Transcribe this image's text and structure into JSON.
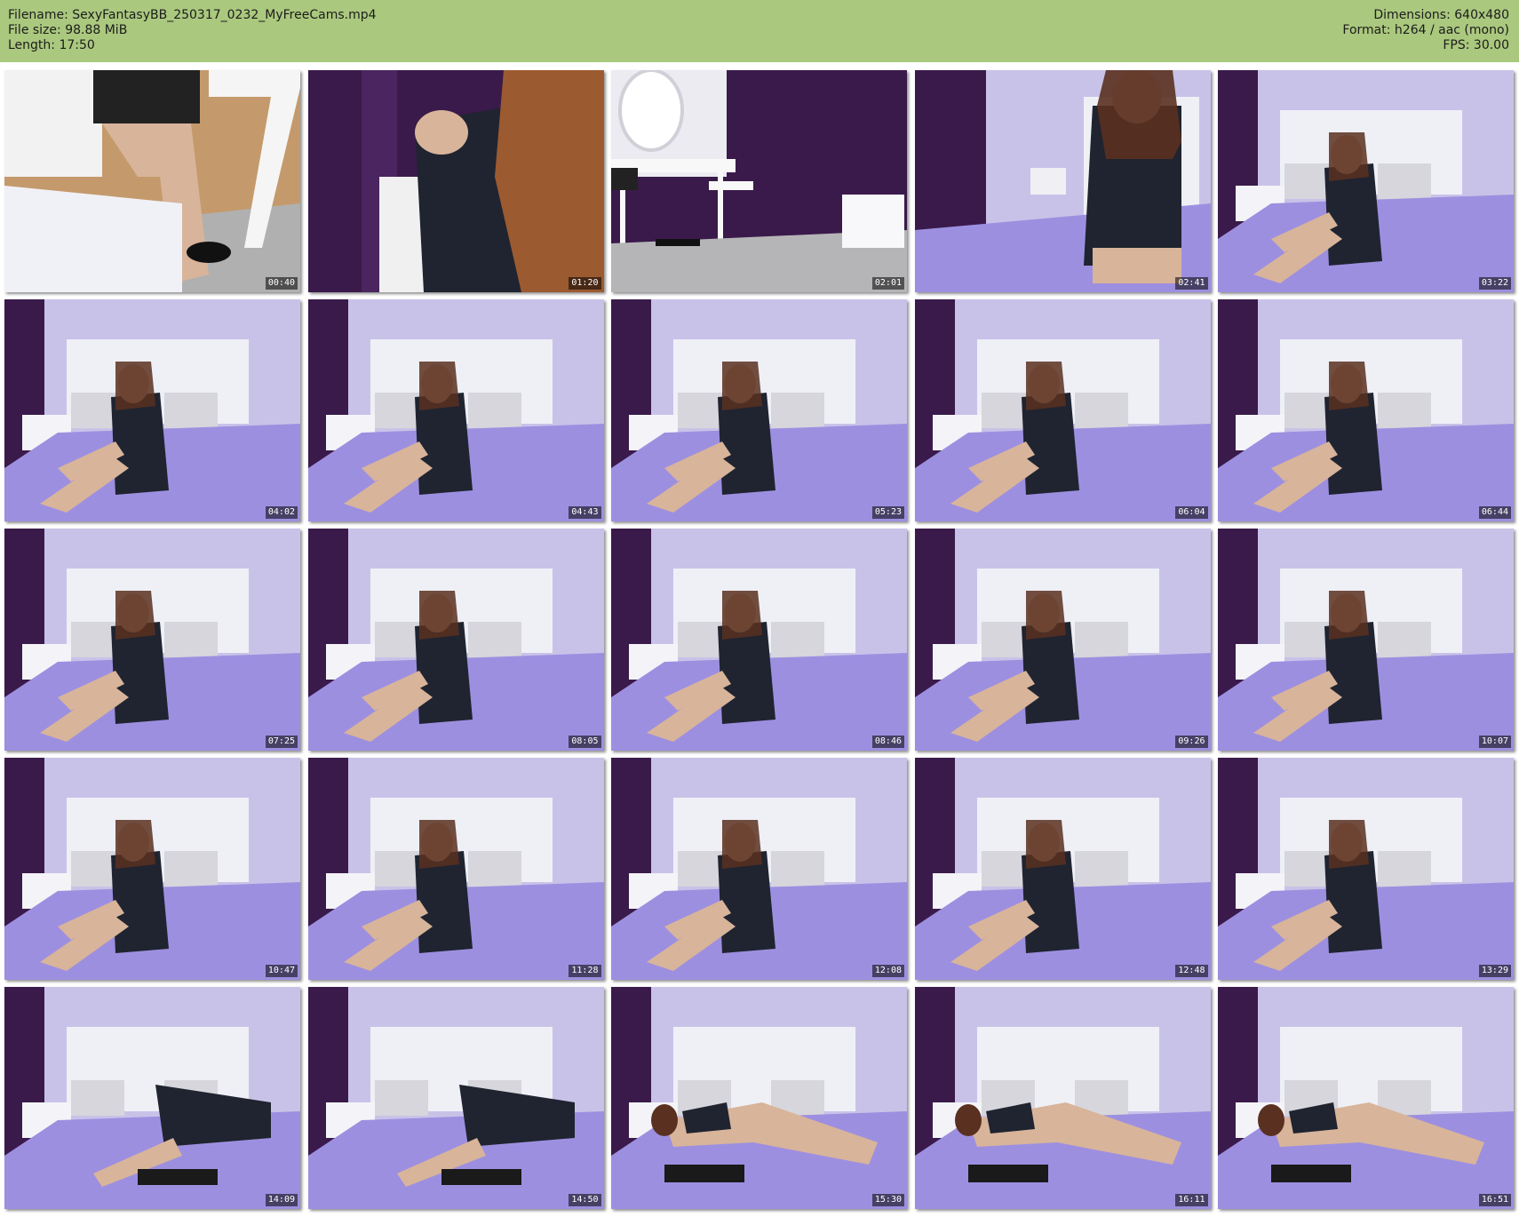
{
  "header": {
    "filename_label": "Filename: SexyFantasyBB_250317_0232_MyFreeCams.mp4",
    "filesize_label": "File size: 98.88 MiB",
    "length_label": "Length: 17:50",
    "dimensions_label": "Dimensions: 640x480",
    "format_label": "Format: h264 / aac (mono)",
    "fps_label": "FPS: 30.00"
  },
  "colors": {
    "header_bg": "#aac87e",
    "wall": "#c9c2e8",
    "curtain": "#3a1a4a",
    "bed": "#9d8fe0",
    "headboard": "#eef0f6",
    "floor": "#c49a6c",
    "dress": "#1f2430",
    "skin": "#d8b49a",
    "hair": "#5a3020"
  },
  "thumbnails": [
    {
      "time": "00:40",
      "scene": "desk-closeup"
    },
    {
      "time": "01:20",
      "scene": "standing-closeup"
    },
    {
      "time": "02:01",
      "scene": "room-vanity"
    },
    {
      "time": "02:41",
      "scene": "sitting-edge"
    },
    {
      "time": "03:22",
      "scene": "sitting-bed"
    },
    {
      "time": "04:02",
      "scene": "sitting-bed"
    },
    {
      "time": "04:43",
      "scene": "sitting-bed"
    },
    {
      "time": "05:23",
      "scene": "sitting-bed"
    },
    {
      "time": "06:04",
      "scene": "sitting-bed"
    },
    {
      "time": "06:44",
      "scene": "sitting-bed"
    },
    {
      "time": "07:25",
      "scene": "sitting-bed"
    },
    {
      "time": "08:05",
      "scene": "sitting-bed"
    },
    {
      "time": "08:46",
      "scene": "sitting-bed"
    },
    {
      "time": "09:26",
      "scene": "sitting-bed"
    },
    {
      "time": "10:07",
      "scene": "sitting-bed"
    },
    {
      "time": "10:47",
      "scene": "sitting-bed"
    },
    {
      "time": "11:28",
      "scene": "sitting-bed"
    },
    {
      "time": "12:08",
      "scene": "sitting-bed"
    },
    {
      "time": "12:48",
      "scene": "sitting-bed"
    },
    {
      "time": "13:29",
      "scene": "sitting-bed"
    },
    {
      "time": "14:09",
      "scene": "kneeling-bed"
    },
    {
      "time": "14:50",
      "scene": "kneeling-bed"
    },
    {
      "time": "15:30",
      "scene": "lying-bed"
    },
    {
      "time": "16:11",
      "scene": "lying-bed"
    },
    {
      "time": "16:51",
      "scene": "lying-bed"
    }
  ]
}
